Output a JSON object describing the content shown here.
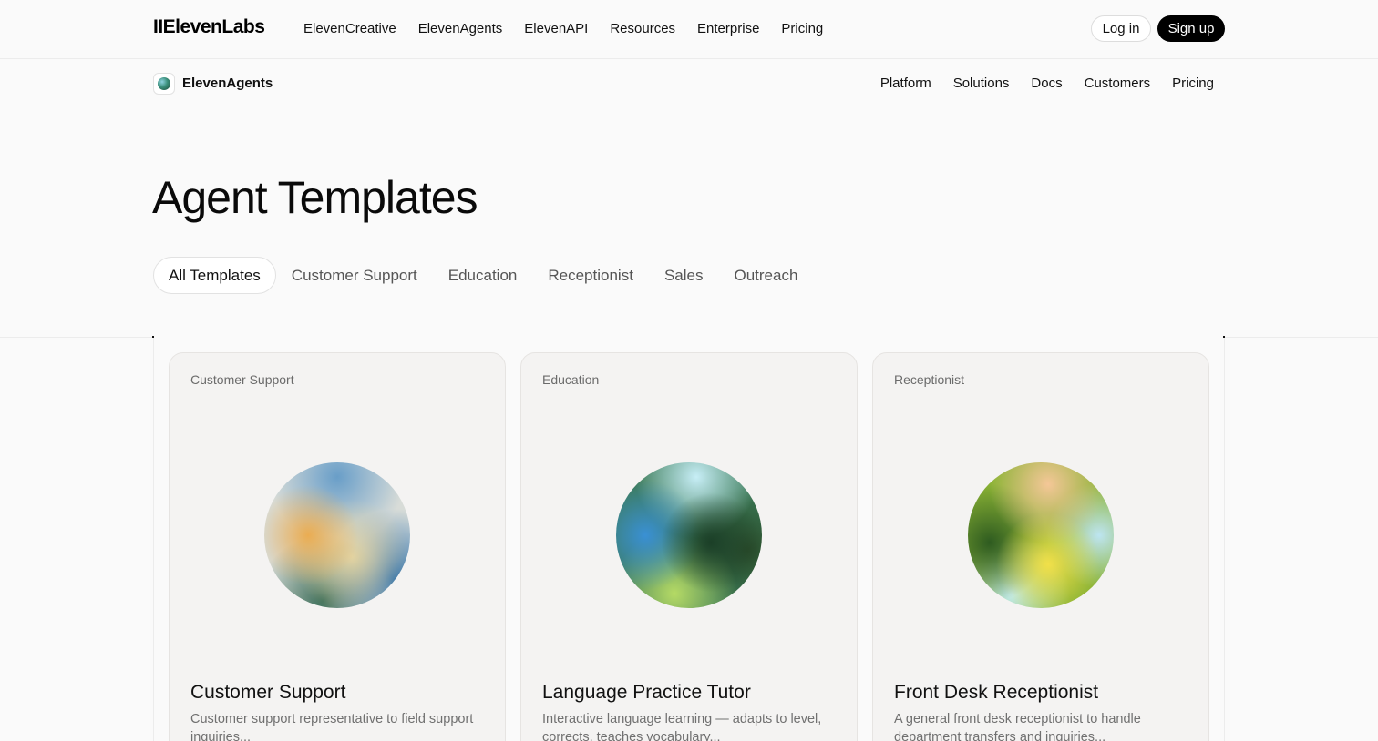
{
  "header": {
    "logo": "IIElevenLabs",
    "nav": [
      "ElevenCreative",
      "ElevenAgents",
      "ElevenAPI",
      "Resources",
      "Enterprise",
      "Pricing"
    ],
    "login_label": "Log in",
    "signup_label": "Sign up"
  },
  "subheader": {
    "product_name": "ElevenAgents",
    "nav": [
      "Platform",
      "Solutions",
      "Docs",
      "Customers",
      "Pricing"
    ]
  },
  "page": {
    "title": "Agent Templates"
  },
  "filters": {
    "selected": "All Templates",
    "tabs": [
      "All Templates",
      "Customer Support",
      "Education",
      "Receptionist",
      "Sales",
      "Outreach"
    ]
  },
  "cards": [
    {
      "category": "Customer Support",
      "title": "Customer Support",
      "description": "Customer support representative to field support inquiries..."
    },
    {
      "category": "Education",
      "title": "Language Practice Tutor",
      "description": "Interactive language learning — adapts to level, corrects, teaches vocabulary..."
    },
    {
      "category": "Receptionist",
      "title": "Front Desk Receptionist",
      "description": "A general front desk receptionist to handle department transfers and inquiries..."
    }
  ]
}
